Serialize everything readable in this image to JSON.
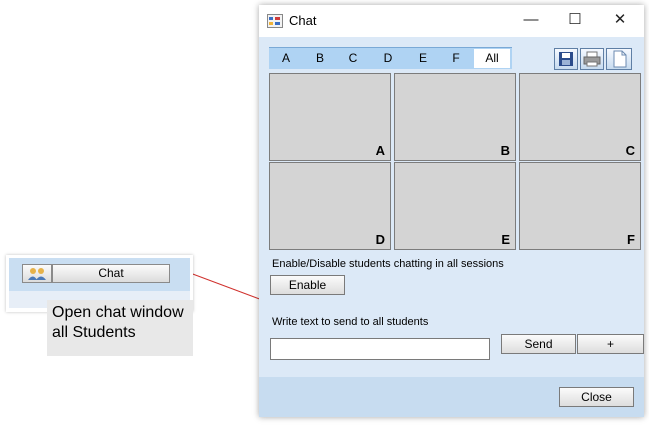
{
  "launcher": {
    "chat_label": "Chat"
  },
  "callout": {
    "line1": "Open chat window",
    "line2": "all Students"
  },
  "window": {
    "title": "Chat",
    "controls": {
      "minimize": "—",
      "maximize": "☐",
      "close": "✕"
    },
    "tabs": [
      "A",
      "B",
      "C",
      "D",
      "E",
      "F",
      "All"
    ],
    "selected_tab": "All",
    "toolbar": [
      "save-icon",
      "print-icon",
      "document-icon"
    ],
    "sessions": [
      "A",
      "B",
      "C",
      "D",
      "E",
      "F"
    ],
    "enable_section": {
      "label": "Enable/Disable students chatting in all sessions",
      "button": "Enable"
    },
    "message_section": {
      "label": "Write text to send to all students",
      "input_value": "",
      "send": "Send",
      "plus": "+"
    },
    "close_button": "Close"
  },
  "colors": {
    "window_bg": "#dce9f7",
    "tab_bar": "#afd3f3",
    "cell_bg": "#d4d4d4",
    "connector": "#d0312d"
  }
}
